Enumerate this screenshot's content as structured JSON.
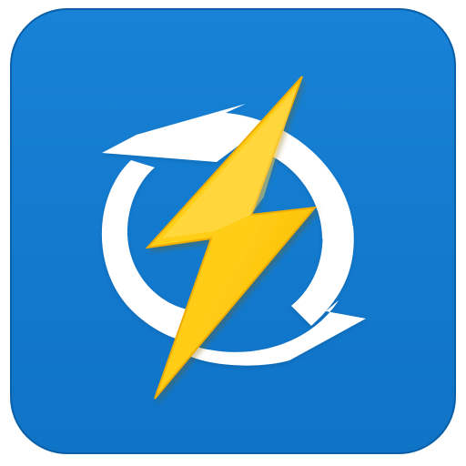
{
  "icon": {
    "name": "lightning-sync-app-icon",
    "depicts": [
      "refresh-arrows",
      "lightning-bolt"
    ],
    "colors": {
      "tile_blue": "#0f73c6",
      "tile_blue_edge": "#0a5fa8",
      "ring_white": "#ffffff",
      "bolt_yellow": "#ffd21f",
      "bolt_orange": "#f4b400",
      "bolt_shadow": "#7a5a00",
      "backdrop": "#ffffff"
    }
  }
}
